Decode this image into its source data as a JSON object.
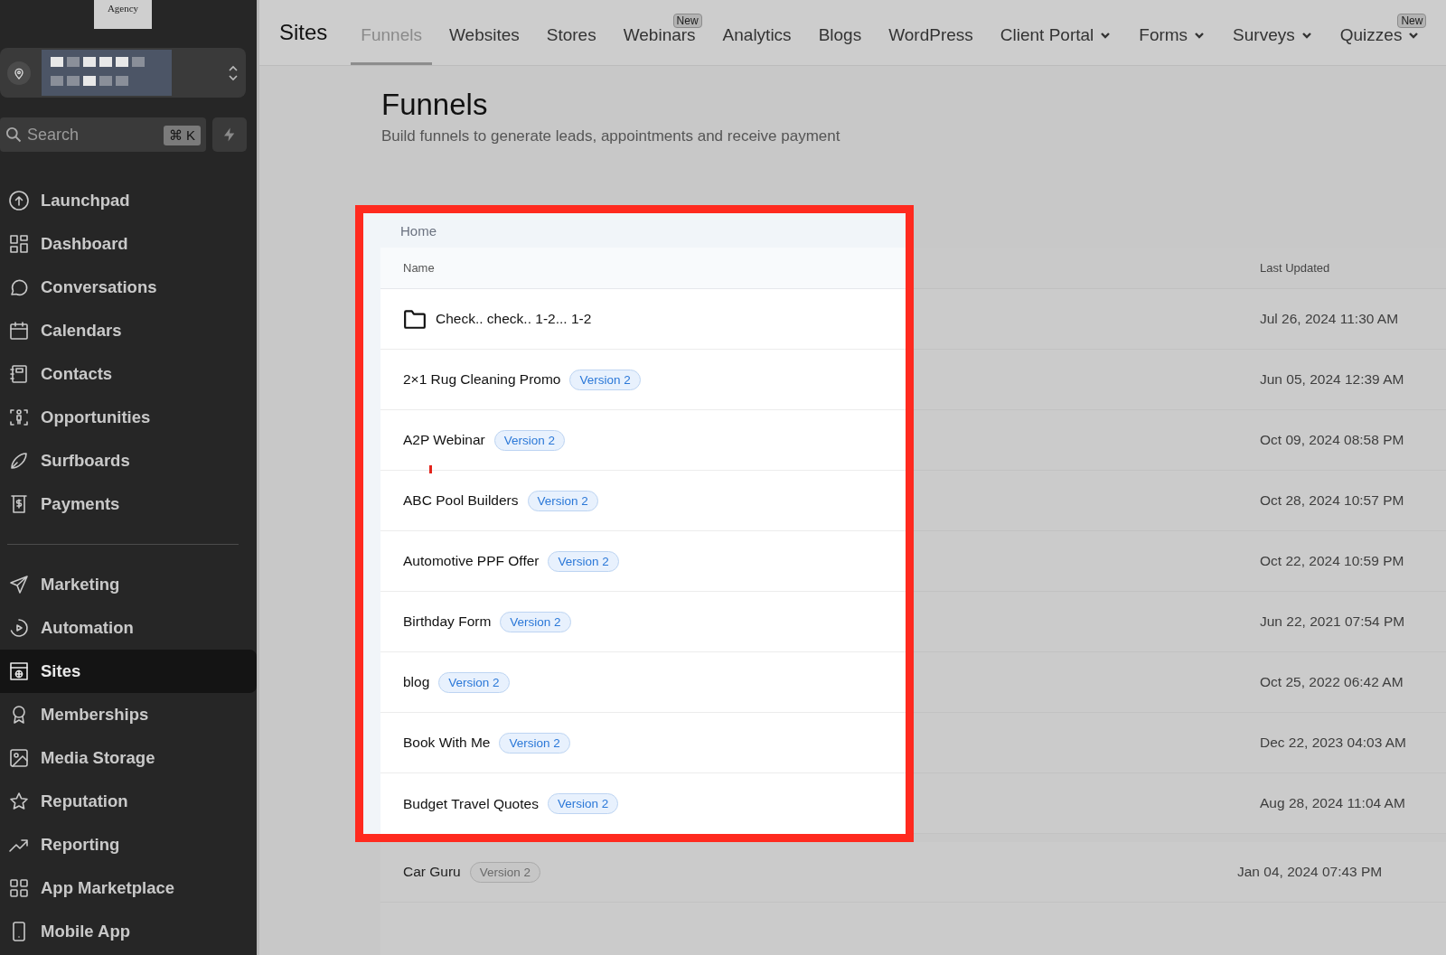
{
  "sidebar": {
    "logo": "Agency",
    "search": {
      "placeholder": "Search",
      "shortcut": "⌘ K"
    },
    "groups": [
      {
        "items": [
          {
            "label": "Launchpad",
            "selected": false
          },
          {
            "label": "Dashboard",
            "selected": false
          },
          {
            "label": "Conversations",
            "selected": false
          },
          {
            "label": "Calendars",
            "selected": false
          },
          {
            "label": "Contacts",
            "selected": false
          },
          {
            "label": "Opportunities",
            "selected": false
          },
          {
            "label": "Surfboards",
            "selected": false
          },
          {
            "label": "Payments",
            "selected": false
          }
        ]
      },
      {
        "items": [
          {
            "label": "Marketing",
            "selected": false
          },
          {
            "label": "Automation",
            "selected": false
          },
          {
            "label": "Sites",
            "selected": true
          },
          {
            "label": "Memberships",
            "selected": false
          },
          {
            "label": "Media Storage",
            "selected": false
          },
          {
            "label": "Reputation",
            "selected": false
          },
          {
            "label": "Reporting",
            "selected": false
          },
          {
            "label": "App Marketplace",
            "selected": false
          },
          {
            "label": "Mobile App",
            "selected": false
          }
        ]
      }
    ]
  },
  "top_nav": {
    "title": "Sites",
    "tabs": [
      {
        "label": "Funnels",
        "selected": true,
        "has_menu": false
      },
      {
        "label": "Websites",
        "selected": false,
        "has_menu": false
      },
      {
        "label": "Stores",
        "selected": false,
        "has_menu": false
      },
      {
        "label": "Webinars",
        "selected": false,
        "has_menu": false,
        "badge": "New"
      },
      {
        "label": "Analytics",
        "selected": false,
        "has_menu": false
      },
      {
        "label": "Blogs",
        "selected": false,
        "has_menu": false
      },
      {
        "label": "WordPress",
        "selected": false,
        "has_menu": false
      },
      {
        "label": "Client Portal",
        "selected": false,
        "has_menu": true
      },
      {
        "label": "Forms",
        "selected": false,
        "has_menu": true
      },
      {
        "label": "Surveys",
        "selected": false,
        "has_menu": true
      },
      {
        "label": "Quizzes",
        "selected": false,
        "has_menu": true,
        "badge": "New"
      }
    ]
  },
  "page": {
    "title": "Funnels",
    "subtitle": "Build funnels to generate leads, appointments and receive payment"
  },
  "table": {
    "breadcrumb": "Home",
    "columns": [
      "Name",
      "Last Updated"
    ],
    "rows": [
      {
        "kind": "folder",
        "name": "Check.. check.. 1-2... 1-2",
        "updated": "Jul 26, 2024 11:30 AM",
        "highlighted": true
      },
      {
        "kind": "funnel",
        "name": "2×1 Rug Cleaning Promo",
        "badge": "Version 2",
        "updated": "Jun 05, 2024 12:39 AM",
        "highlighted": true
      },
      {
        "kind": "funnel",
        "name": "A2P Webinar",
        "badge": "Version 2",
        "updated": "Oct 09, 2024 08:58 PM",
        "highlighted": true
      },
      {
        "kind": "funnel",
        "name": "ABC Pool Builders",
        "badge": "Version 2",
        "updated": "Oct 28, 2024 10:57 PM",
        "highlighted": true
      },
      {
        "kind": "funnel",
        "name": "Automotive PPF Offer",
        "badge": "Version 2",
        "updated": "Oct 22, 2024 10:59 PM",
        "highlighted": true
      },
      {
        "kind": "funnel",
        "name": "Birthday Form",
        "badge": "Version 2",
        "updated": "Jun 22, 2021 07:54 PM",
        "highlighted": true
      },
      {
        "kind": "funnel",
        "name": "blog",
        "badge": "Version 2",
        "updated": "Oct 25, 2022 06:42 AM",
        "highlighted": true
      },
      {
        "kind": "funnel",
        "name": "Book With Me",
        "badge": "Version 2",
        "updated": "Dec 22, 2023 04:03 AM",
        "highlighted": true
      },
      {
        "kind": "funnel",
        "name": "Budget Travel Quotes",
        "badge": "Version 2",
        "updated": "Aug 28, 2024 11:04 AM",
        "highlighted": true
      },
      {
        "kind": "funnel",
        "name": "Car Guru",
        "badge": "Version 2",
        "updated": "Jan 04, 2024 07:43 PM",
        "highlighted": false
      }
    ]
  }
}
